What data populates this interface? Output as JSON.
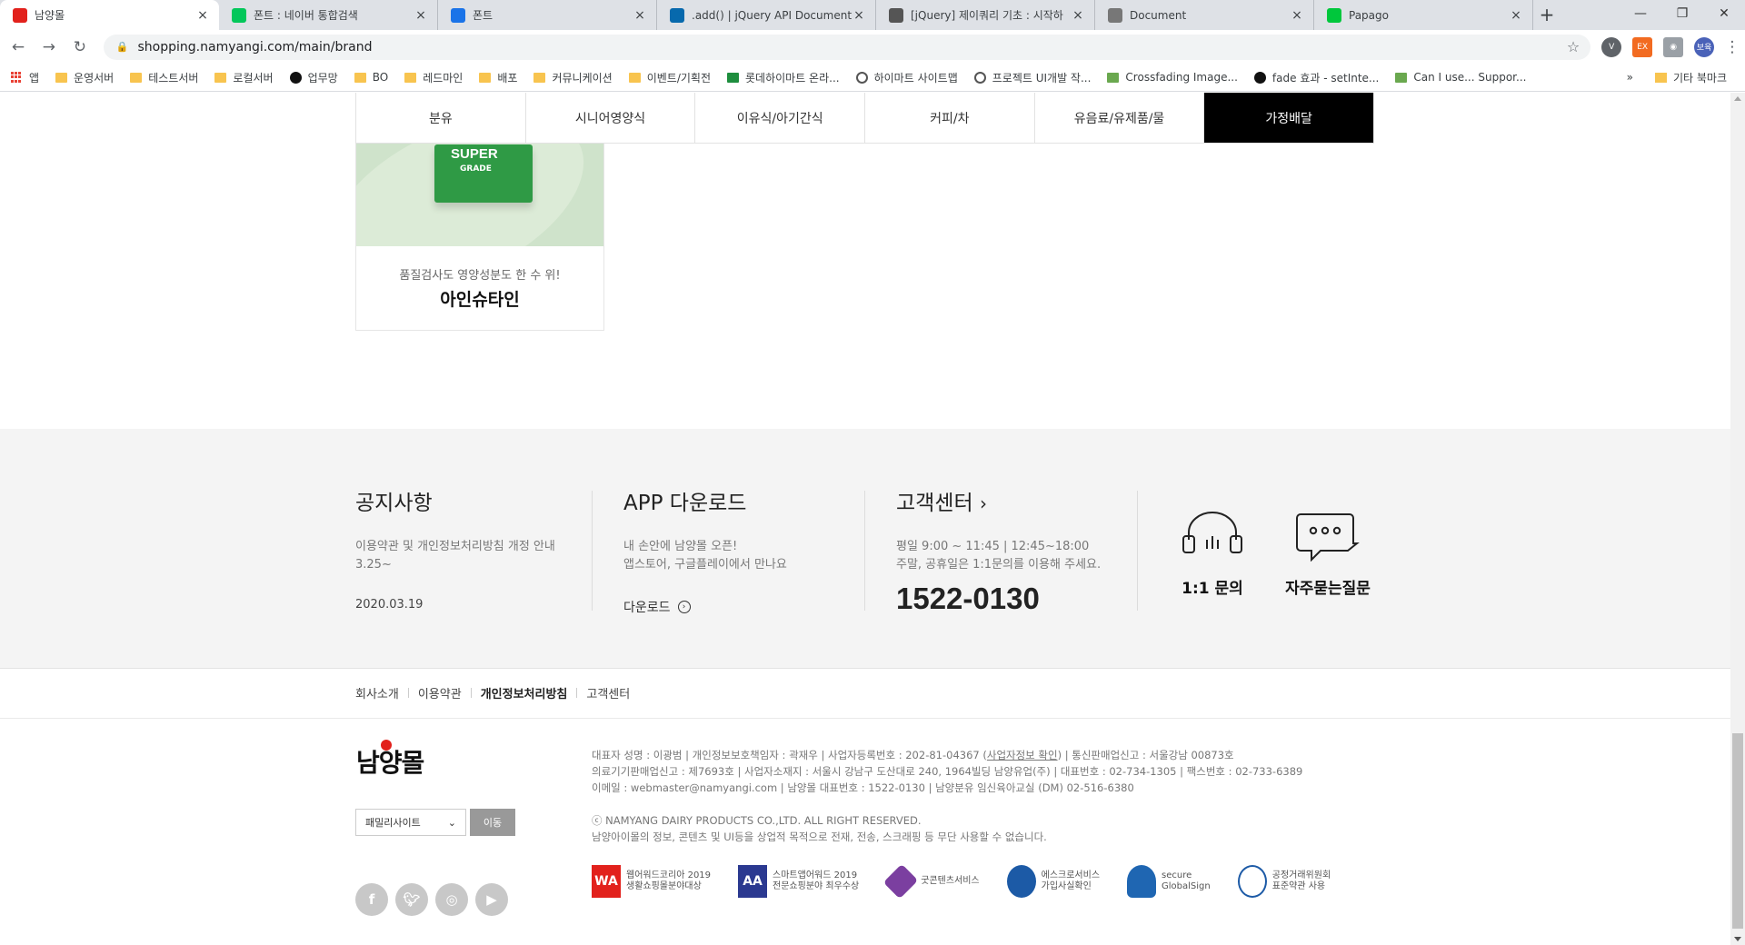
{
  "browser": {
    "tabs": [
      {
        "title": "남양몰",
        "active": true,
        "fav_color": "#e2211c"
      },
      {
        "title": "폰트 : 네이버 통합검색",
        "active": false,
        "fav_color": "#03c75a"
      },
      {
        "title": "폰트",
        "active": false,
        "fav_color": "#1a73e8"
      },
      {
        "title": ".add() | jQuery API Documentati",
        "active": false,
        "fav_color": "#0769ad"
      },
      {
        "title": "[jQuery] 제이쿼리 기초 : 시작하",
        "active": false,
        "fav_color": "#555555"
      },
      {
        "title": "Document",
        "active": false,
        "fav_color": "#777777"
      },
      {
        "title": "Papago",
        "active": false,
        "fav_color": "#00c73c"
      }
    ],
    "url": "shopping.namyangi.com/main/brand",
    "profile_label": "보육",
    "bookmarks": [
      "앱",
      "운영서버",
      "테스트서버",
      "로컬서버",
      "업무망",
      "BO",
      "레드마인",
      "배포",
      "커뮤니케이션",
      "이벤트/기획전",
      "롯데하이마트 온라...",
      "하이마트 사이트맵",
      "프로젝트 UI개발 작...",
      "Crossfading Image...",
      "fade 효과 - setInte...",
      "Can I use... Suppor..."
    ],
    "bookmarks_more": "»",
    "other_bookmarks": "기타 북마크"
  },
  "categories": [
    {
      "label": "분유",
      "active": false
    },
    {
      "label": "시니어영양식",
      "active": false
    },
    {
      "label": "이유식/아기간식",
      "active": false
    },
    {
      "label": "커피/차",
      "active": false
    },
    {
      "label": "유음료/유제품/물",
      "active": false
    },
    {
      "label": "가정배달",
      "active": true
    }
  ],
  "product": {
    "box_line1": "SUPER",
    "box_line2": "GRADE",
    "desc": "품질검사도 영양성분도 한 수 위!",
    "name": "아인슈타인"
  },
  "footer": {
    "notice": {
      "title": "공지사항",
      "text": "이용약관 및 개인정보처리방침 개정 안내 3.25~",
      "date": "2020.03.19"
    },
    "app": {
      "title": "APP 다운로드",
      "line1": "내 손안에 남양몰 오픈!",
      "line2": "앱스토어, 구글플레이에서 만나요",
      "download": "다운로드"
    },
    "cs": {
      "title": "고객센터",
      "hours": "평일 9:00 ~ 11:45 | 12:45~18:00",
      "weekend": "주말, 공휴일은 1:1문의를 이용해 주세요.",
      "phone": "1522-0130"
    },
    "inquiry": "1:1 문의",
    "faq": "자주묻는질문",
    "links": [
      "회사소개",
      "이용약관",
      "개인정보처리방침",
      "고객센터"
    ],
    "logo": "남양몰",
    "family_select": "패밀리사이트",
    "go_button": "이동",
    "social": [
      "facebook",
      "twitter",
      "instagram",
      "youtube"
    ],
    "corp_line1a": "대표자 성명 : 이광범  |  개인정보보호책임자 : 곽재우  |  사업자등록번호 : 202-81-04367 (",
    "corp_link": "사업자정보 확인",
    "corp_line1b": ")  |  통신판매업신고 : 서울강남 00873호",
    "corp_line2": "의료기기판매업신고 : 제7693호  |  사업자소재지 : 서울시 강남구 도산대로 240, 1964빌딩 남양유업(주)  |  대표번호 : 02-734-1305  |  팩스번호 : 02-733-6389",
    "corp_line3": "이메일 : webmaster@namyangi.com  |  남양몰 대표번호 : 1522-0130  |  남양분유 임신육아교실 (DM) 02-516-6380",
    "copyright": "ⓒ NAMYANG DAIRY PRODUCTS CO.,LTD. ALL RIGHT RESERVED.",
    "copyright_note": "남양아이몰의 정보, 콘텐츠 및 UI등을 상업적 목적으로 전재, 전송, 스크래핑 등 무단 사용할 수 없습니다.",
    "awards": [
      {
        "mark": "WA",
        "color": "#e2211c",
        "line1": "웹어워드코리아 2019",
        "line2": "생활쇼핑몰분야대상"
      },
      {
        "mark": "AA",
        "color": "#2b3990",
        "line1": "스마트앱어워드 2019",
        "line2": "전문쇼핑분야 최우수상"
      },
      {
        "mark": "",
        "color": "#7b3fa0",
        "line1": "굿콘텐츠서비스",
        "line2": ""
      },
      {
        "mark": "",
        "color": "#1c5aa6",
        "line1": "에스크로서비스",
        "line2": "가입사실확인"
      },
      {
        "mark": "",
        "color": "#1f66b2",
        "line1": "secure",
        "line2": "GlobalSign"
      },
      {
        "mark": "",
        "color": "#ffffff",
        "line1": "공정거래위원회",
        "line2": "표준약관 사용"
      }
    ]
  }
}
